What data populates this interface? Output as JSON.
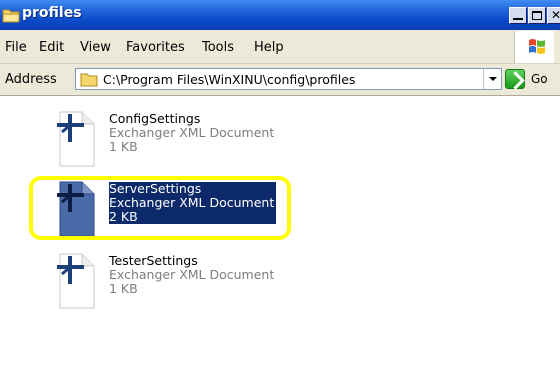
{
  "window": {
    "title": "profiles"
  },
  "menu": {
    "items": [
      "File",
      "Edit",
      "View",
      "Favorites",
      "Tools",
      "Help"
    ]
  },
  "address": {
    "label": "Address",
    "value": "C:\\Program Files\\WinXINU\\config\\profiles",
    "go_label": "Go"
  },
  "files": [
    {
      "name": "ConfigSettings",
      "type": "Exchanger XML Document",
      "size": "1 KB",
      "selected": false
    },
    {
      "name": "ServerSettings",
      "type": "Exchanger XML Document",
      "size": "2 KB",
      "selected": true
    },
    {
      "name": "TesterSettings",
      "type": "Exchanger XML Document",
      "size": "1 KB",
      "selected": false
    }
  ],
  "colors": {
    "titlebar": "#0a49c8",
    "selection": "#0c2a6a",
    "highlight": "#ffff00"
  },
  "icons": {
    "title": "folder-icon",
    "address": "folder-icon",
    "go": "go-arrow-icon",
    "file": "xml-document-icon",
    "brand": "windows-logo-icon"
  }
}
